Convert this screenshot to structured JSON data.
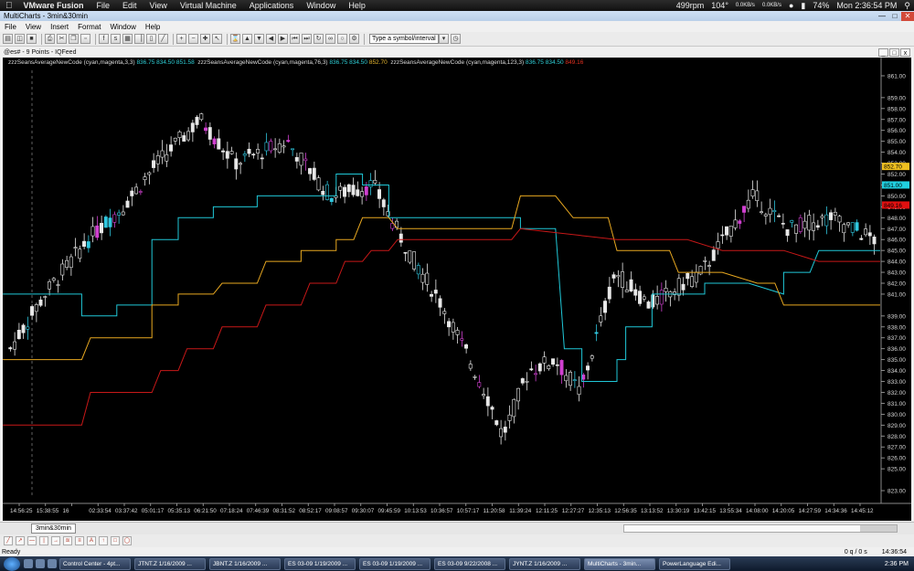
{
  "mac_menubar": {
    "brand": "VMware Fusion",
    "items": [
      "File",
      "Edit",
      "View",
      "Virtual Machine",
      "Applications",
      "Window",
      "Help"
    ],
    "status": {
      "rpm": "499rpm",
      "temp": "104°",
      "net_top": "0.0KB/s",
      "net_bottom": "0.0KB/s",
      "battery": "74%",
      "clock": "Mon 2:36:54 PM"
    }
  },
  "window": {
    "title": "MultiCharts - 3min&30min"
  },
  "app_menu": {
    "items": [
      "File",
      "View",
      "Insert",
      "Format",
      "Window",
      "Help"
    ]
  },
  "toolbar": {
    "symbol_placeholder": "Type a symbol/interval"
  },
  "chart_window": {
    "title": "@es# - 9 Points - IQFeed"
  },
  "status_line": {
    "study1_name": "zzzSeansAverageNewCode  (cyan,magenta,3,3)",
    "study1_v1": "836.75",
    "study1_v2": "834.50",
    "study1_v3": "851.58",
    "study2_name": "zzzSeansAverageNewCode  (cyan,magenta,76,3)",
    "study2_v1": "836.75",
    "study2_v2": "834.50",
    "study2_v3": "852.70",
    "study3_name": "zzzSeansAverageNewCode  (cyan,magenta,123,3)",
    "study3_v1": "836.75",
    "study3_v2": "834.50",
    "study3_v3": "849.16"
  },
  "chart_data": {
    "type": "candlestick",
    "y_ticks": [
      861,
      859,
      858,
      857,
      856,
      855,
      854,
      853,
      852,
      851,
      850,
      849,
      848,
      847,
      846,
      845,
      844,
      843,
      842,
      841,
      839,
      838,
      837,
      836,
      835,
      834,
      833,
      832,
      831,
      830,
      829,
      828,
      827,
      826,
      825,
      823
    ],
    "ylim": [
      822.5,
      861.5
    ],
    "x_tick_labels": [
      "14:56:25",
      "15:38:55",
      "16",
      "02:33:54",
      "03:37:42",
      "05:01:17",
      "05:35:13",
      "06:21:50",
      "07:18:24",
      "07:46:39",
      "08:31:52",
      "08:52:17",
      "09:08:57",
      "09:30:07",
      "09:45:59",
      "10:13:53",
      "10:36:57",
      "10:57:17",
      "11:20:58",
      "11:39:24",
      "12:11:25",
      "12:27:27",
      "12:35:13",
      "12:56:35",
      "13:13:52",
      "13:30:19",
      "13:42:15",
      "13:55:34",
      "14:08:00",
      "14:20:05",
      "14:27:59",
      "14:34:36",
      "14:45:12"
    ],
    "price_markers": [
      {
        "value": "852.70",
        "color": "#f0c020"
      },
      {
        "value": "851.00",
        "color": "#20d0e0"
      },
      {
        "value": "849.16",
        "color": "#e01010"
      }
    ],
    "candle_count": 200,
    "series": [
      {
        "color": "#20c8d8",
        "points": [
          [
            0,
            841
          ],
          [
            0.04,
            841
          ],
          [
            0.09,
            841
          ],
          [
            0.09,
            839
          ],
          [
            0.13,
            839
          ],
          [
            0.13,
            840
          ],
          [
            0.17,
            840
          ],
          [
            0.17,
            846
          ],
          [
            0.2,
            846
          ],
          [
            0.2,
            848
          ],
          [
            0.24,
            848
          ],
          [
            0.24,
            849
          ],
          [
            0.29,
            849
          ],
          [
            0.29,
            850
          ],
          [
            0.38,
            850
          ],
          [
            0.38,
            852
          ],
          [
            0.41,
            852
          ],
          [
            0.41,
            851
          ],
          [
            0.44,
            851
          ],
          [
            0.44,
            848
          ],
          [
            0.59,
            848
          ],
          [
            0.59,
            847
          ],
          [
            0.63,
            847
          ],
          [
            0.64,
            836
          ],
          [
            0.66,
            836
          ],
          [
            0.66,
            833
          ],
          [
            0.7,
            833
          ],
          [
            0.7,
            835
          ],
          [
            0.71,
            835
          ],
          [
            0.71,
            838
          ],
          [
            0.74,
            838
          ],
          [
            0.74,
            841
          ],
          [
            0.8,
            841
          ],
          [
            0.8,
            842
          ],
          [
            0.85,
            842
          ],
          [
            0.89,
            841
          ],
          [
            0.89,
            843
          ],
          [
            0.92,
            843
          ],
          [
            0.93,
            845
          ],
          [
            1,
            845
          ]
        ]
      },
      {
        "color": "#e8a820",
        "points": [
          [
            0,
            835
          ],
          [
            0.09,
            835
          ],
          [
            0.1,
            837
          ],
          [
            0.17,
            837
          ],
          [
            0.17,
            840
          ],
          [
            0.2,
            840
          ],
          [
            0.2,
            841
          ],
          [
            0.24,
            841
          ],
          [
            0.25,
            842
          ],
          [
            0.29,
            842
          ],
          [
            0.3,
            844
          ],
          [
            0.34,
            844
          ],
          [
            0.34,
            845
          ],
          [
            0.38,
            845
          ],
          [
            0.38,
            846
          ],
          [
            0.4,
            846
          ],
          [
            0.41,
            848
          ],
          [
            0.44,
            848
          ],
          [
            0.45,
            847
          ],
          [
            0.58,
            847
          ],
          [
            0.59,
            850
          ],
          [
            0.63,
            850
          ],
          [
            0.65,
            848
          ],
          [
            0.69,
            848
          ],
          [
            0.7,
            845
          ],
          [
            0.76,
            845
          ],
          [
            0.77,
            843
          ],
          [
            0.82,
            843
          ],
          [
            0.86,
            842
          ],
          [
            0.88,
            842
          ],
          [
            0.89,
            840
          ],
          [
            1,
            840
          ]
        ]
      },
      {
        "color": "#c81818",
        "points": [
          [
            0,
            829
          ],
          [
            0.09,
            829
          ],
          [
            0.1,
            832
          ],
          [
            0.17,
            832
          ],
          [
            0.18,
            834
          ],
          [
            0.2,
            834
          ],
          [
            0.21,
            836
          ],
          [
            0.24,
            836
          ],
          [
            0.25,
            838
          ],
          [
            0.29,
            838
          ],
          [
            0.3,
            840
          ],
          [
            0.34,
            840
          ],
          [
            0.35,
            842
          ],
          [
            0.38,
            842
          ],
          [
            0.39,
            844
          ],
          [
            0.41,
            844
          ],
          [
            0.42,
            845
          ],
          [
            0.44,
            845
          ],
          [
            0.45,
            846
          ],
          [
            0.58,
            846
          ],
          [
            0.59,
            847
          ],
          [
            0.7,
            846
          ],
          [
            0.78,
            846
          ],
          [
            0.82,
            845
          ],
          [
            0.89,
            845
          ],
          [
            0.93,
            844
          ],
          [
            1,
            844
          ]
        ]
      }
    ]
  },
  "bottom_tab": {
    "label": "3min&30min"
  },
  "status_bar": {
    "left": "Ready",
    "middle": "0 q / 0 s",
    "right": "14:36:54"
  },
  "taskbar": {
    "tasks": [
      "Control Center - 4pt...",
      "JTNT.Z 1/16/2009 ...",
      "JBNT.Z 1/16/2009 ...",
      "ES 03-09 1/19/2009 ...",
      "ES 03-09 1/19/2009 ...",
      "ES 03-09 9/22/2008 ...",
      "JYNT.Z 1/16/2009 ...",
      "MultiCharts - 3min...",
      "PowerLanguage Edi..."
    ],
    "clock": "2:36 PM"
  }
}
